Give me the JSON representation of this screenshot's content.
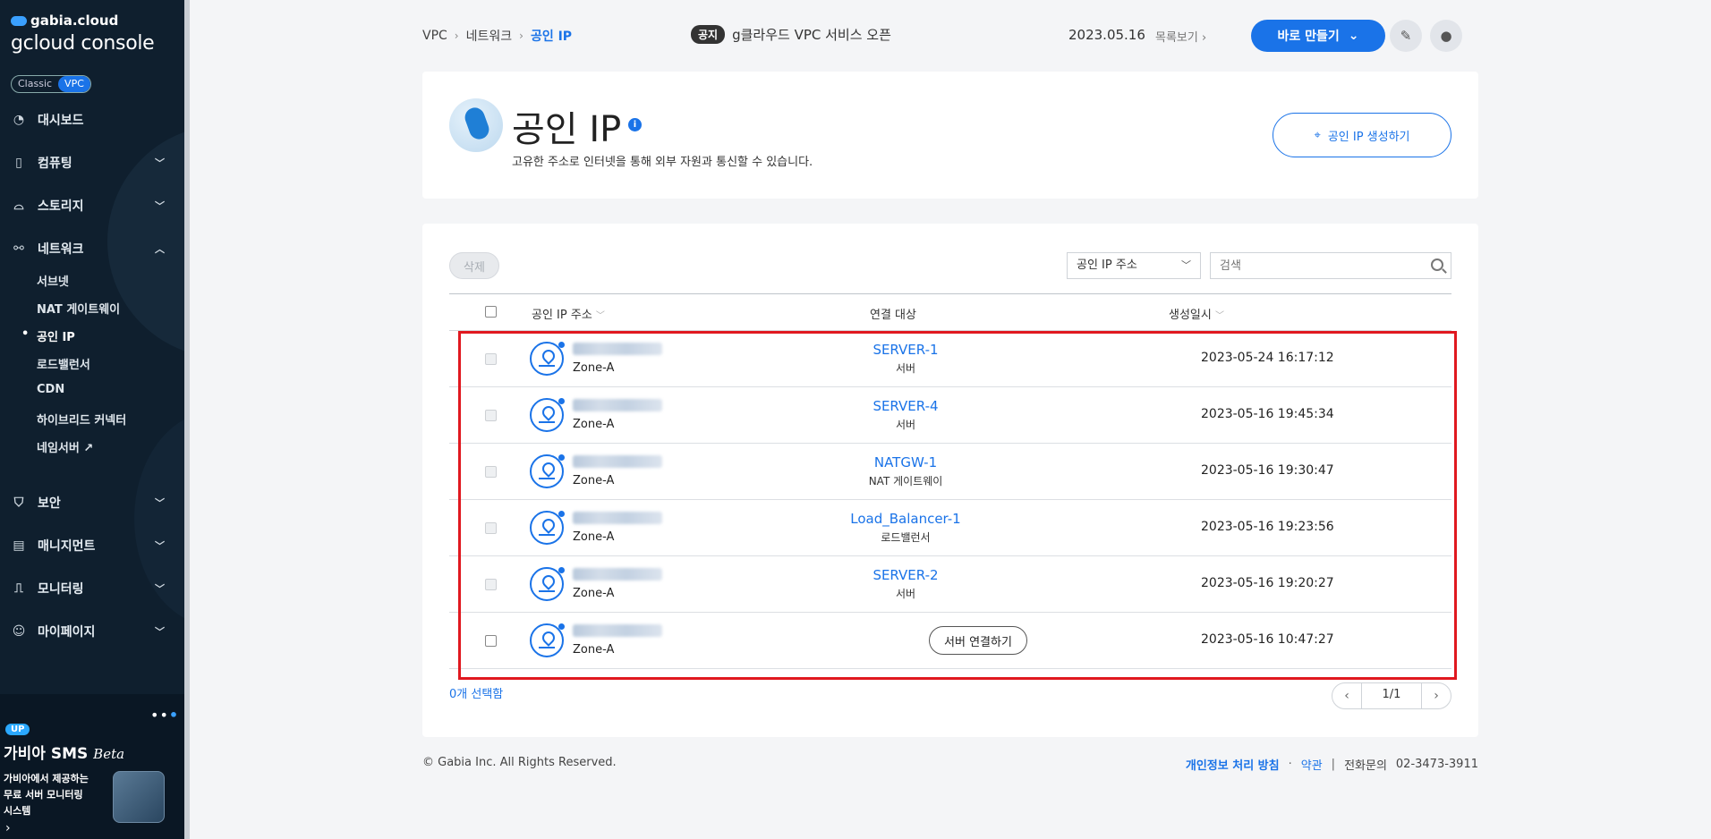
{
  "sidebar": {
    "logo_top": "gabia.cloud",
    "logo_bottom": "gcloud console",
    "toggle": [
      "Classic",
      "VPC"
    ],
    "items": [
      {
        "label": "대시보드"
      },
      {
        "label": "컴퓨팅"
      },
      {
        "label": "스토리지"
      },
      {
        "label": "네트워크"
      },
      {
        "label": "보안"
      },
      {
        "label": "매니지먼트"
      },
      {
        "label": "모니터링"
      },
      {
        "label": "마이페이지"
      }
    ],
    "network_sub": [
      "서브넷",
      "NAT 게이트웨이",
      "공인 IP",
      "로드밸런서",
      "CDN",
      "하이브리드 커넥터",
      "네임서버"
    ],
    "active_sub": "공인 IP",
    "promo": {
      "badge": "UP",
      "title": "가비아 SMS",
      "title_suffix": "Beta",
      "desc_lines": [
        "가비아에서 제공하는",
        "무료 서버 모니터링",
        "시스템"
      ]
    }
  },
  "header": {
    "breadcrumb": [
      "VPC",
      "네트워크",
      "공인 IP"
    ],
    "notice_tag": "공지",
    "notice_text": "g클라우드 VPC 서비스 오픈",
    "notice_date": "2023.05.16",
    "notice_more": "목록보기",
    "make_button": "바로 만들기"
  },
  "page": {
    "title": "공인 IP",
    "description": "고유한 주소로 인터넷을 통해 외부 자원과 통신할 수 있습니다.",
    "create_button": "공인 IP 생성하기"
  },
  "toolbar": {
    "delete_button": "삭제",
    "filter_value": "공인 IP 주소",
    "search_placeholder": "검색"
  },
  "table": {
    "columns": [
      "공인 IP 주소",
      "연결 대상",
      "생성일시"
    ],
    "rows": [
      {
        "zone": "Zone-A",
        "target": "SERVER-1",
        "target_type": "서버",
        "created": "2023-05-24 16:17:12"
      },
      {
        "zone": "Zone-A",
        "target": "SERVER-4",
        "target_type": "서버",
        "created": "2023-05-16 19:45:34"
      },
      {
        "zone": "Zone-A",
        "target": "NATGW-1",
        "target_type": "NAT 게이트웨이",
        "created": "2023-05-16 19:30:47"
      },
      {
        "zone": "Zone-A",
        "target": "Load_Balancer-1",
        "target_type": "로드밸런서",
        "created": "2023-05-16 19:23:56"
      },
      {
        "zone": "Zone-A",
        "target": "SERVER-2",
        "target_type": "서버",
        "created": "2023-05-16 19:20:27"
      },
      {
        "zone": "Zone-A",
        "target_button": "서버 연결하기",
        "created": "2023-05-16 10:47:27"
      }
    ],
    "selected_count": "0개 선택함",
    "pagination": "1/1"
  },
  "footer": {
    "copyright": "© Gabia Inc. All Rights Reserved.",
    "privacy": "개인정보 처리 방침",
    "terms": "약관",
    "phone_label": "전화문의",
    "phone": "02-3473-3911"
  },
  "colors": {
    "accent": "#1a73e8",
    "sidebar_bg": "#0f1f2e",
    "highlight": "#e0181f"
  }
}
